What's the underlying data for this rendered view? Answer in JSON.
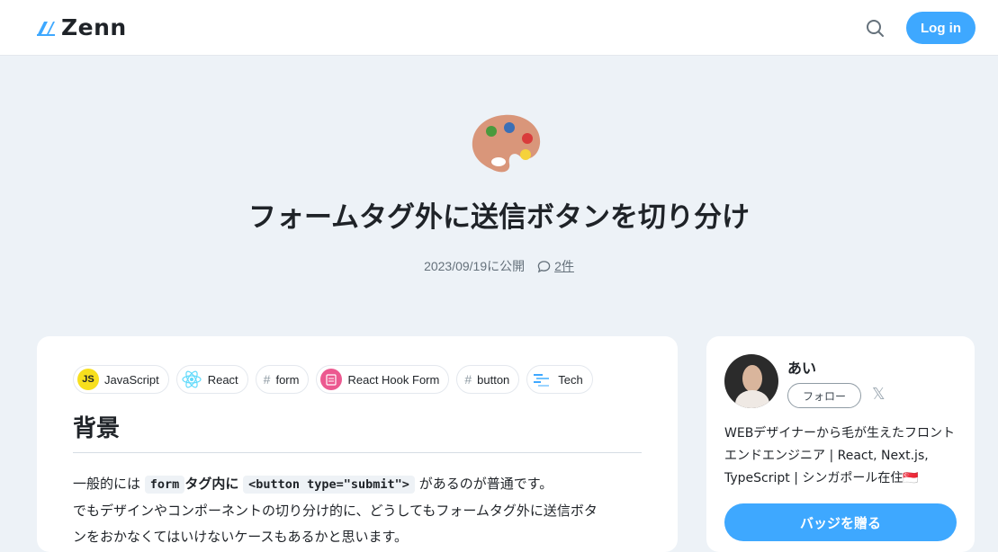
{
  "header": {
    "logo_text": "Zenn",
    "login_label": "Log in",
    "brand_color": "#3ea8ff"
  },
  "article": {
    "emoji": "artist-palette-icon",
    "title": "フォームタグ外に送信ボタンを切り分け",
    "published": "2023/09/19に公開",
    "comments_count": "2件",
    "topics": [
      {
        "label": "JavaScript",
        "icon": "javascript-icon"
      },
      {
        "label": "React",
        "icon": "react-icon"
      },
      {
        "label": "form",
        "icon": "hash-icon"
      },
      {
        "label": "React Hook Form",
        "icon": "react-hook-form-icon"
      },
      {
        "label": "button",
        "icon": "hash-icon"
      },
      {
        "label": "Tech",
        "icon": "tech-icon"
      }
    ],
    "heading": "背景",
    "para1": {
      "t1": "一般的には",
      "code1": "form",
      "t2": "タグ内に",
      "code2": "<button type=\"submit\">",
      "t3": "があるのが普通です。"
    },
    "para2": "でもデザインやコンポーネントの切り分け的に、どうしてもフォームタグ外に送信ボタ",
    "para3": "ンをおかなくてはいけないケースもあるかと思います。"
  },
  "profile": {
    "name": "あい",
    "follow_label": "フォロー",
    "bio": "WEBデザイナーから毛が生えたフロントエンドエンジニア | React, Next.js, TypeScript | シンガポール在住🇸🇬",
    "badge_label": "バッジを贈る"
  }
}
